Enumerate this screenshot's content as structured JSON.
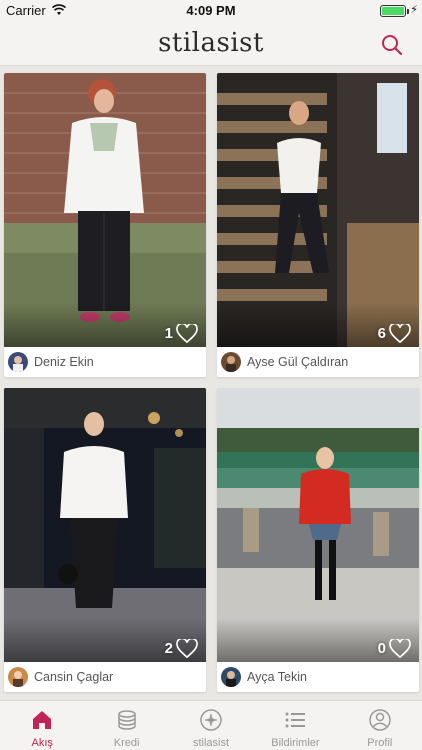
{
  "status_bar": {
    "carrier": "Carrier",
    "time": "4:09 PM"
  },
  "header": {
    "logo": "stilasist"
  },
  "colors": {
    "accent": "#c0245a",
    "inactive": "#999999"
  },
  "posts": [
    {
      "author": "Deniz Ekin",
      "likes": "1"
    },
    {
      "author": "Ayse Gül Çaldıran",
      "likes": "6"
    },
    {
      "author": "Cansin Çaglar",
      "likes": "2"
    },
    {
      "author": "Ayça Tekin",
      "likes": "0"
    }
  ],
  "tabs": [
    {
      "label": "Akış",
      "icon": "home-icon",
      "active": true
    },
    {
      "label": "Kredi",
      "icon": "coins-icon",
      "active": false
    },
    {
      "label": "stilasist",
      "icon": "compass-icon",
      "active": false
    },
    {
      "label": "Bildirimler",
      "icon": "list-icon",
      "active": false
    },
    {
      "label": "Profil",
      "icon": "user-icon",
      "active": false
    }
  ]
}
